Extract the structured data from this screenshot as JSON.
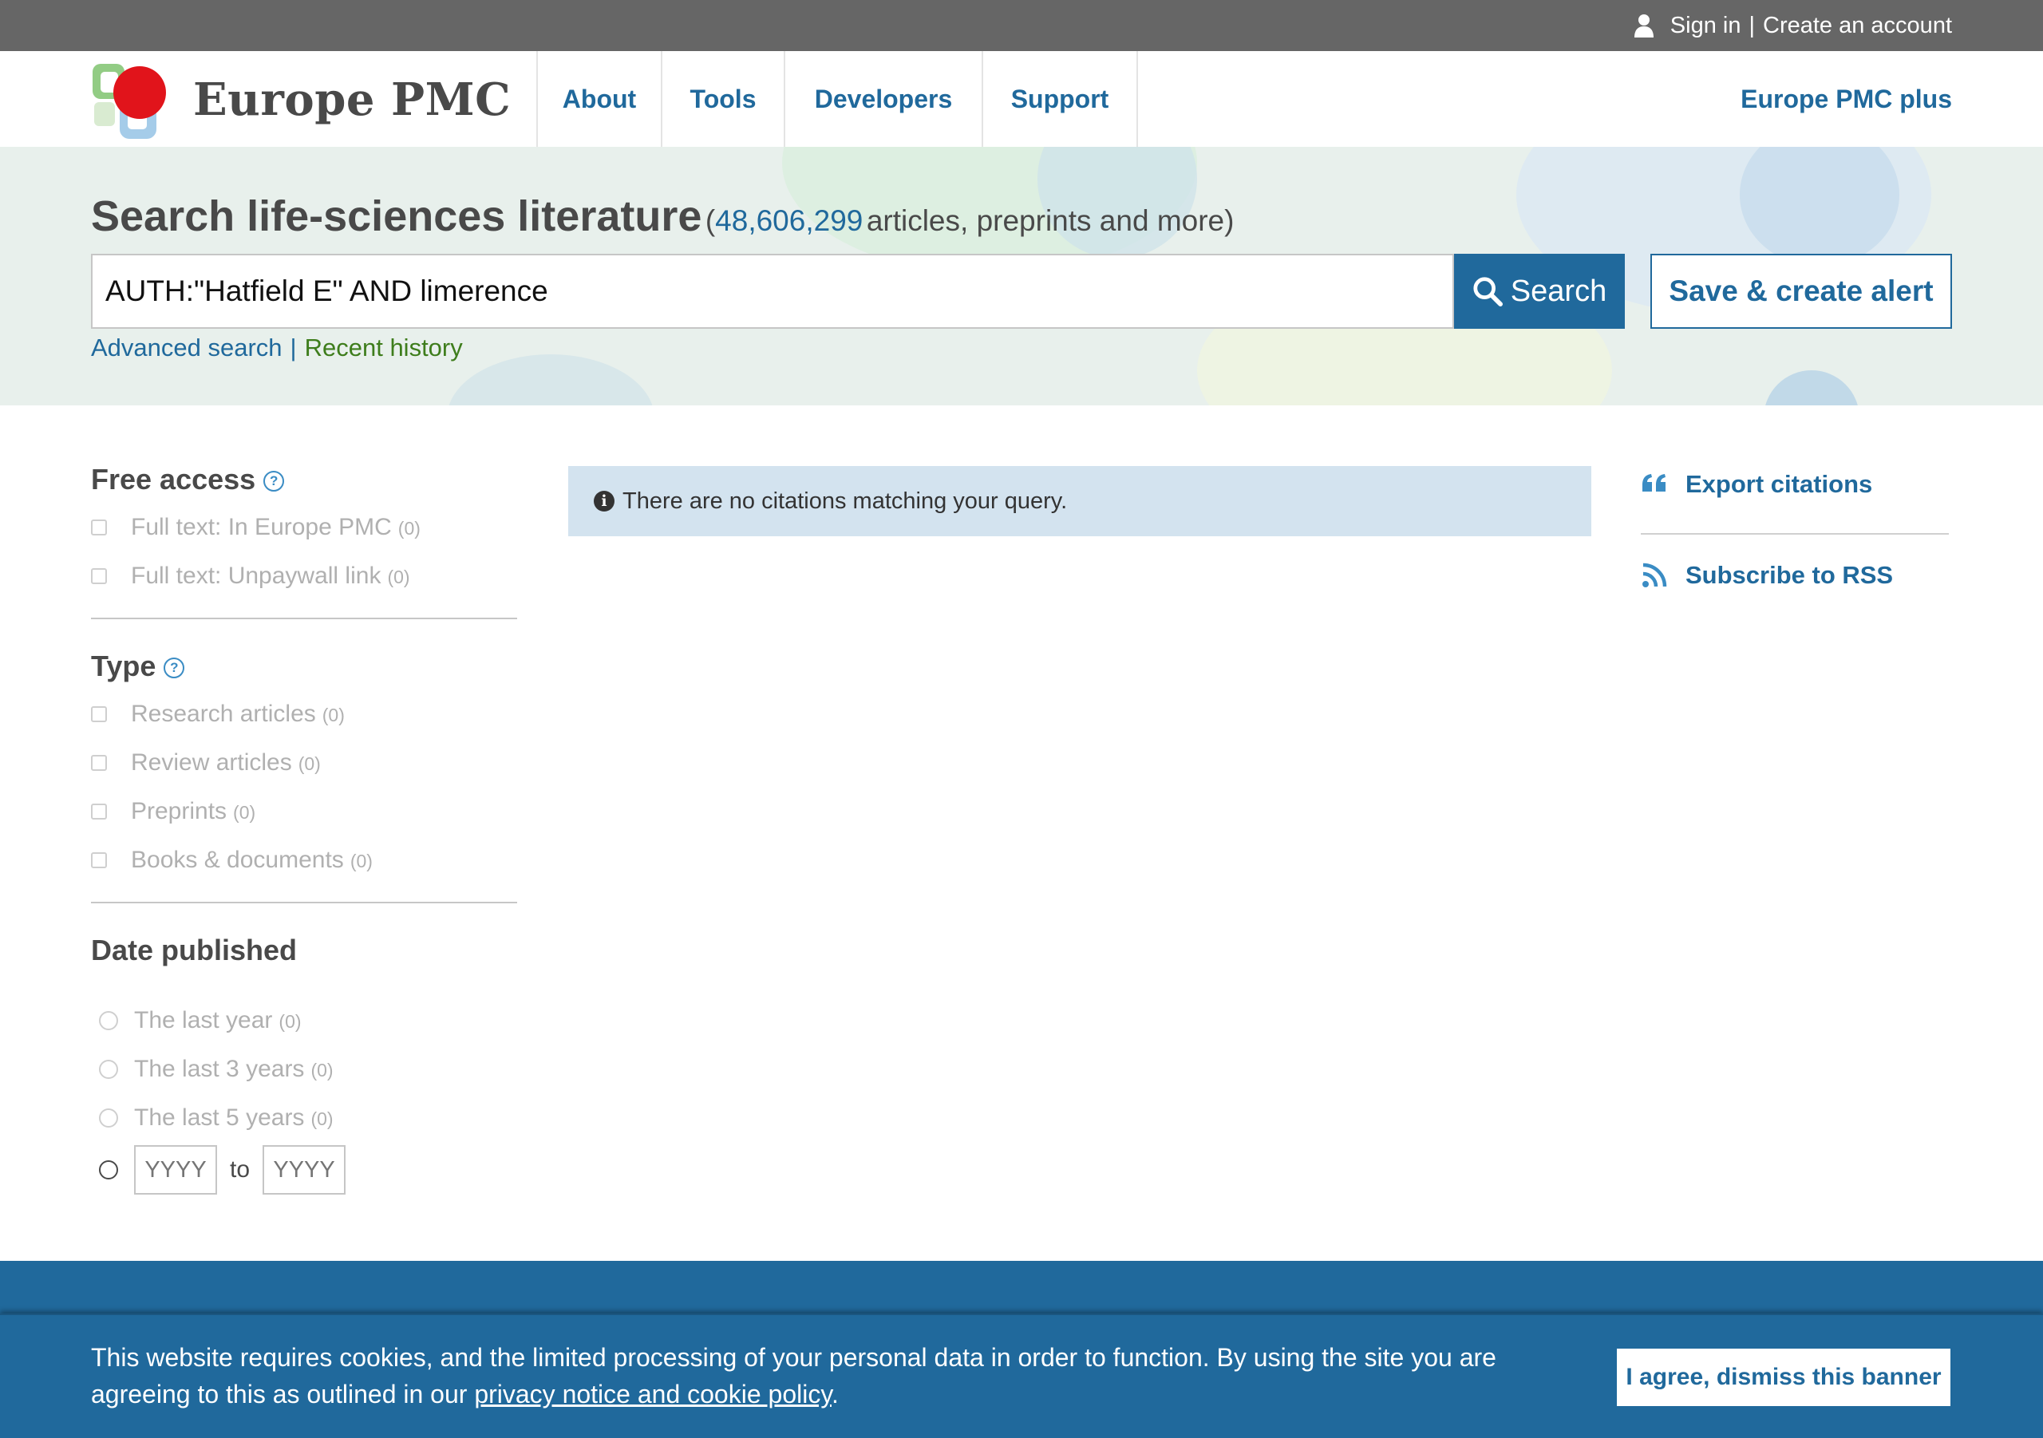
{
  "topbar": {
    "sign_in": "Sign in",
    "separator": "|",
    "create_account": "Create an account"
  },
  "header": {
    "logo_text": "Europe PMC",
    "nav": [
      "About",
      "Tools",
      "Developers",
      "Support"
    ],
    "plus_link": "Europe PMC plus"
  },
  "search": {
    "title": "Search life-sciences literature",
    "count_open": "(",
    "count": "48,606,299",
    "count_rest": "articles, preprints and more)",
    "query": "AUTH:\"Hatfield E\" AND limerence",
    "search_button": "Search",
    "alert_button": "Save & create alert",
    "advanced_link": "Advanced search",
    "link_separator": "|",
    "history_link": "Recent history"
  },
  "filters": {
    "free_access": {
      "heading": "Free access",
      "help": "?",
      "options": [
        {
          "label": "Full text: In Europe PMC",
          "count": "(0)"
        },
        {
          "label": "Full text: Unpaywall link",
          "count": "(0)"
        }
      ]
    },
    "type": {
      "heading": "Type",
      "help": "?",
      "options": [
        {
          "label": "Research articles",
          "count": "(0)"
        },
        {
          "label": "Review articles",
          "count": "(0)"
        },
        {
          "label": "Preprints",
          "count": "(0)"
        },
        {
          "label": "Books & documents",
          "count": "(0)"
        }
      ]
    },
    "date": {
      "heading": "Date published",
      "options": [
        {
          "label": "The last year",
          "count": "(0)"
        },
        {
          "label": "The last 3 years",
          "count": "(0)"
        },
        {
          "label": "The last 5 years",
          "count": "(0)"
        }
      ],
      "from_placeholder": "YYYY",
      "to_label": "to",
      "to_placeholder": "YYYY"
    }
  },
  "results": {
    "message_icon": "i",
    "message": "There are no citations matching your query."
  },
  "actions": {
    "export": "Export citations",
    "rss": "Subscribe to RSS"
  },
  "cookie": {
    "text": "This website requires cookies, and the limited processing of your personal data in order to function. By using the site you are agreeing to this as outlined in our",
    "link": "privacy notice and cookie policy",
    "period": ".",
    "button": "I agree, dismiss this banner"
  },
  "colors": {
    "topbar": "#666666",
    "primary": "#20699c",
    "history_link": "#3e7d1c",
    "message_bg": "#d3e3ef",
    "search_band": "#e8f0ec"
  }
}
